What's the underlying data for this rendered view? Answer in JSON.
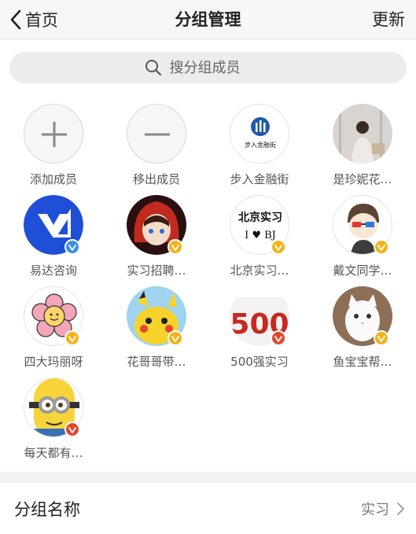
{
  "nav": {
    "back_label": "首页",
    "title": "分组管理",
    "update_label": "更新"
  },
  "search": {
    "placeholder": "搜分组成员"
  },
  "actions": {
    "add_label": "添加成员",
    "remove_label": "移出成员"
  },
  "members": [
    {
      "name": "步入金融街",
      "badge": "none",
      "logo_text": "步入金融街"
    },
    {
      "name": "是珍妮花…",
      "badge": "none"
    },
    {
      "name": "易达咨询",
      "badge": "blue"
    },
    {
      "name": "实习招聘…",
      "badge": "gold"
    },
    {
      "name": "北京实习…",
      "badge": "gold",
      "pic_line1": "北京实习",
      "pic_line2": "I ♥ BJ"
    },
    {
      "name": "戴文同学…",
      "badge": "gold"
    },
    {
      "name": "四大玛丽呀",
      "badge": "gold"
    },
    {
      "name": "花哥哥带…",
      "badge": "gold"
    },
    {
      "name": "500强实习",
      "badge": "red",
      "pic_text": "500"
    },
    {
      "name": "鱼宝宝帮…",
      "badge": "gold"
    },
    {
      "name": "每天都有…",
      "badge": "red"
    }
  ],
  "group_name": {
    "label": "分组名称",
    "value": "实习"
  },
  "colors": {
    "gold_badge": "#f2b31b",
    "blue_badge": "#3b8fe6",
    "red_badge": "#e0482f",
    "nav_bg": "#f7f7f7"
  }
}
